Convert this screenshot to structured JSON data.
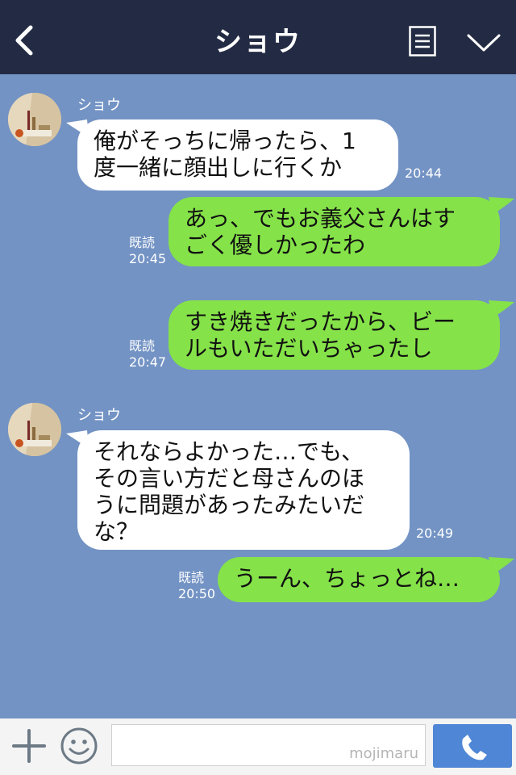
{
  "header": {
    "title": "ショウ"
  },
  "messages": [
    {
      "sender": "ショウ",
      "text": "俺がそっちに帰ったら、1\n度一緒に顔出しに行くか",
      "time": "20:44"
    },
    {
      "text": "あっ、でもお義父さんはす\nごく優しかったわ",
      "read": "既読",
      "time": "20:45"
    },
    {
      "text": "すき焼きだったから、ビー\nルもいただいちゃったし",
      "read": "既読",
      "time": "20:47"
    },
    {
      "sender": "ショウ",
      "text": "それならよかった…でも、\nその言い方だと母さんのほ\nうに問題があったみたいだ\nな？",
      "time": "20:49"
    },
    {
      "text": "うーん、ちょっとね…",
      "read": "既読",
      "time": "20:50"
    }
  ],
  "input": {
    "watermark": "mojimaru"
  },
  "colors": {
    "header": "#232b44",
    "background": "#7393c4",
    "outgoing": "#85e249",
    "incoming": "#ffffff",
    "call": "#4f86d6"
  }
}
